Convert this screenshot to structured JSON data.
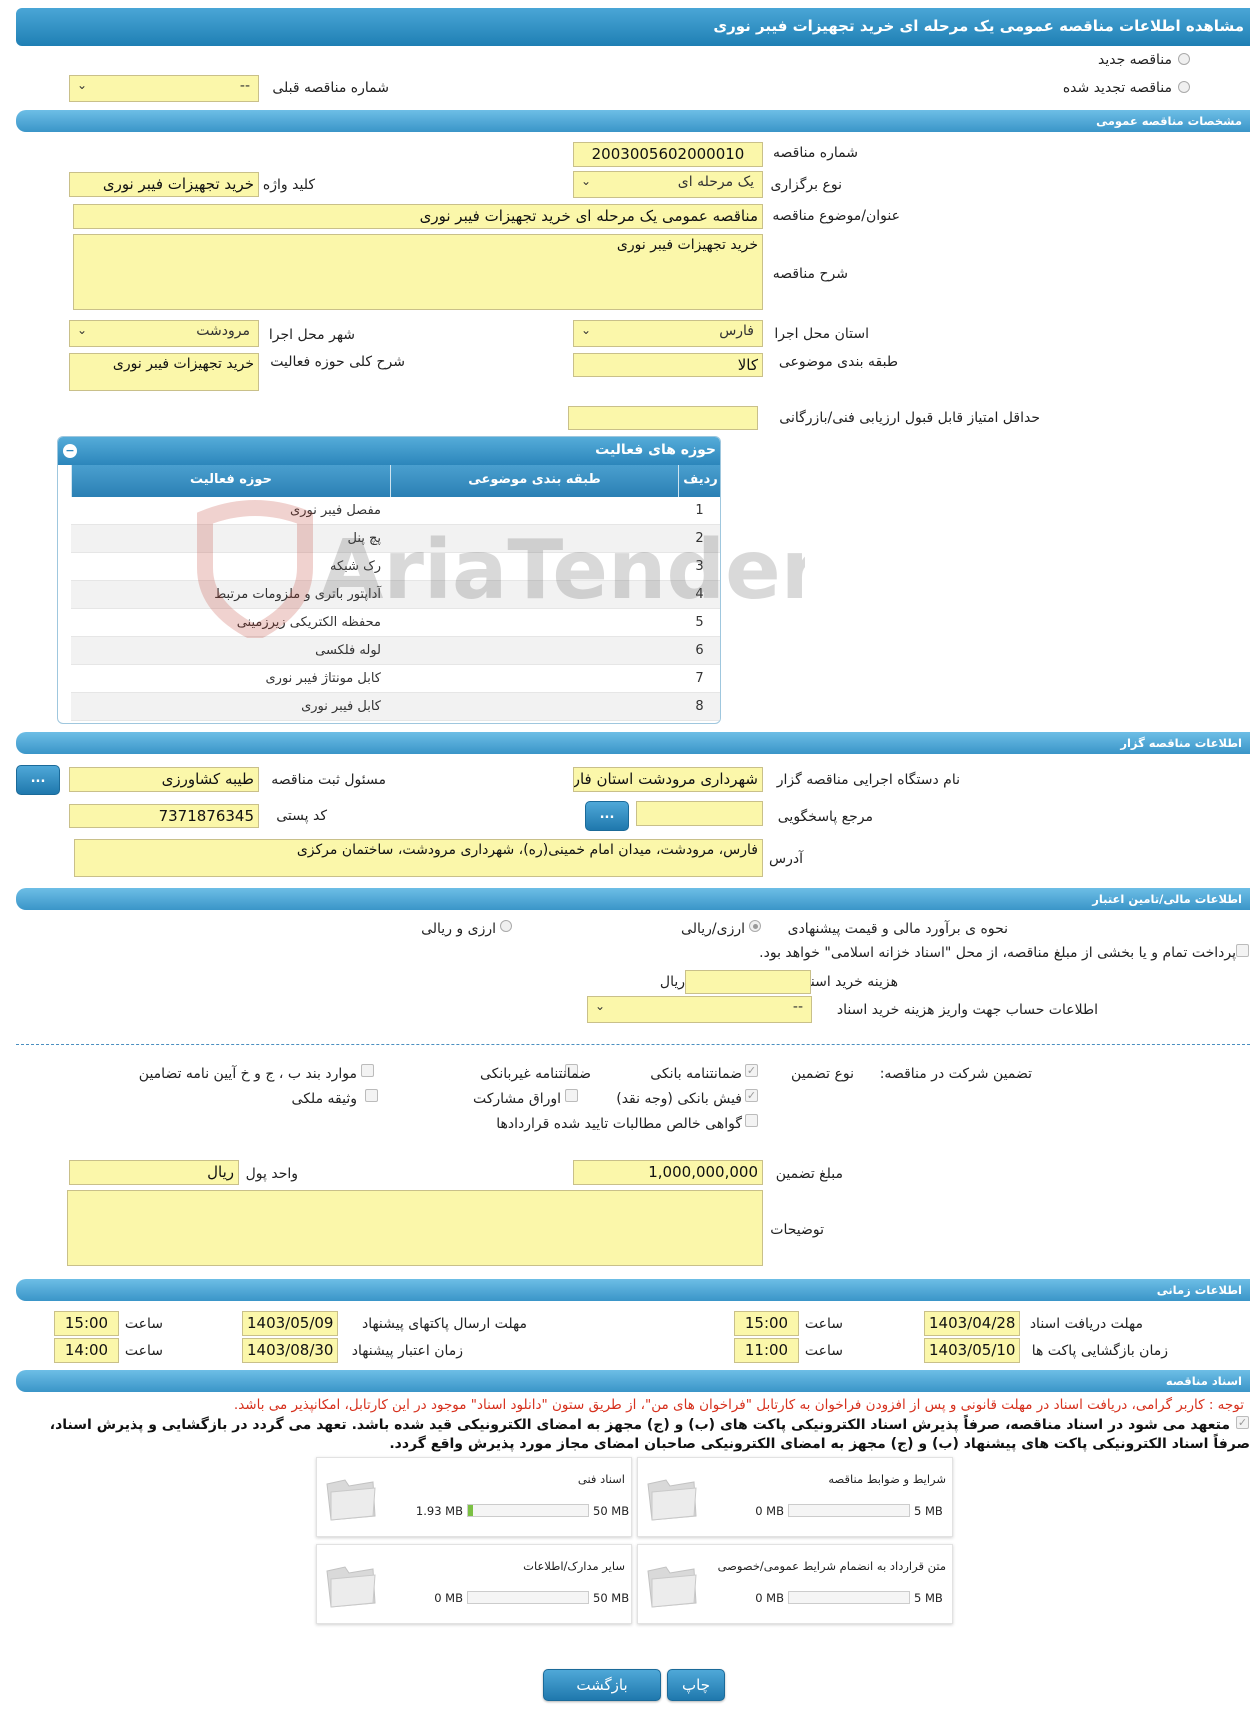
{
  "page": {
    "title": "مشاهده اطلاعات مناقصه عمومی یک مرحله ای خرید تجهیزات فیبر نوری"
  },
  "top": {
    "radio_new": "مناقصه جدید",
    "radio_renewed": "مناقصه تجدید شده",
    "prev_number_label": "شماره مناقصه قبلی",
    "prev_number_value": "--"
  },
  "general": {
    "header": "مشخصات مناقصه عمومی",
    "number_label": "شماره مناقصه",
    "number_value": "2003005602000010",
    "type_label": "نوع برگزاری",
    "type_value": "یک مرحله ای",
    "keyword_label": "کلید واژه",
    "keyword_value": "خرید تجهیزات فیبر نوری",
    "subject_label": "عنوان/موضوع مناقصه",
    "subject_value": "مناقصه عمومی یک مرحله ای خرید تجهیزات فیبر نوری",
    "desc_label": "شرح مناقصه",
    "desc_value": "خرید تجهیزات فیبر نوری",
    "province_label": "استان محل اجرا",
    "province_value": "فارس",
    "city_label": "شهر محل اجرا",
    "city_value": "مرودشت",
    "category_label": "طبقه بندی موضوعی",
    "category_value": "کالا",
    "activity_desc_label": "شرح کلی حوزه فعالیت",
    "activity_desc_value": "خرید تجهیزات فیبر نوری",
    "min_score_label": "حداقل امتیاز قابل قبول ارزیابی فنی/بازرگانی",
    "min_score_value": ""
  },
  "activities": {
    "header": "حوزه های فعالیت",
    "collapse_icon": "minus-circle-icon",
    "columns": [
      "ردیف",
      "طبقه بندی موضوعی",
      "حوزه فعالیت"
    ],
    "rows": [
      {
        "n": "1",
        "cat": "",
        "area": "مفصل فیبر نوری"
      },
      {
        "n": "2",
        "cat": "",
        "area": "پچ پنل"
      },
      {
        "n": "3",
        "cat": "",
        "area": "رک شبکه"
      },
      {
        "n": "4",
        "cat": "",
        "area": "آداپتور باتری و ملزومات مرتبط"
      },
      {
        "n": "5",
        "cat": "",
        "area": "محفظه الکتریکی زیرزمینی"
      },
      {
        "n": "6",
        "cat": "",
        "area": "لوله فلکسی"
      },
      {
        "n": "7",
        "cat": "",
        "area": "کابل مونتاژ فیبر نوری"
      },
      {
        "n": "8",
        "cat": "",
        "area": "کابل فیبر نوری"
      }
    ]
  },
  "organizer": {
    "header": "اطلاعات مناقصه گزار",
    "org_label": "نام دستگاه اجرایی مناقصه گزار",
    "org_value": "شهرداری مرودشت استان فارس",
    "registrar_label": "مسئول ثبت مناقصه",
    "registrar_value": "طیبه کشاورزی",
    "ref_label": "مرجع پاسخگویی",
    "ref_value": "",
    "postal_label": "کد پستی",
    "postal_value": "7371876345",
    "address_label": "آدرس",
    "address_value": "فارس، مرودشت، میدان امام خمینی(ره)، شهرداری مرودشت، ساختمان مرکزی",
    "btn_label": "..."
  },
  "finance": {
    "header": "اطلاعات مالی/تامین اعتبار",
    "method_label": "نحوه ی برآورد مالی و قیمت پیشنهادی",
    "opt_rial": "ارزی/ریالی",
    "opt_fx_rial": "ارزی و ریالی",
    "treasury_text": "پرداخت تمام و یا بخشی از مبلغ مناقصه، از محل \"اسناد خزانه اسلامی\" خواهد بود.",
    "doc_fee_label": "هزینه خرید اسناد",
    "doc_fee_value": "",
    "doc_fee_unit": "ریال",
    "account_label": "اطلاعات حساب جهت واریز هزینه خرید اسناد",
    "account_value": "--"
  },
  "guarantee": {
    "title": "تضمین شرکت در مناقصه:",
    "type_label": "نوع تضمین",
    "options": {
      "bank_guarantee": "ضمانتنامه بانکی",
      "non_bank_guarantee": "ضمانتنامه غیربانکی",
      "other_cases": "موارد بند ب ، ج و خ آیین نامه تضامین",
      "bank_receipt": "فیش بانکی (وجه نقد)",
      "bonds": "اوراق مشارکت",
      "property": "وثیقه ملکی",
      "net_claims": "گواهی خالص مطالبات تایید شده قراردادها"
    },
    "amount_label": "مبلغ تضمین",
    "amount_value": "1,000,000,000",
    "currency_label": "واحد پول",
    "currency_value": "ریال",
    "notes_label": "توضیحات",
    "notes_value": ""
  },
  "timing": {
    "header": "اطلاعات زمانی",
    "doc_deadline_label": "مهلت دریافت اسناد",
    "doc_deadline_date": "1403/04/28",
    "doc_deadline_time": "15:00",
    "submit_deadline_label": "مهلت ارسال پاکتهای پیشنهاد",
    "submit_deadline_date": "1403/05/09",
    "submit_deadline_time": "15:00",
    "opening_label": "زمان بازگشایی پاکت ها",
    "opening_date": "1403/05/10",
    "opening_time": "11:00",
    "validity_label": "زمان اعتبار پیشنهاد",
    "validity_date": "1403/08/30",
    "validity_time": "14:00",
    "hour_label": "ساعت"
  },
  "documents": {
    "header": "اسناد مناقصه",
    "note_red": "توجه : کاربر گرامی، دریافت اسناد در مهلت قانونی و پس از افزودن فراخوان به کارتابل \"فراخوان های من\"، از طریق ستون \"دانلود اسناد\" موجود در این کارتابل، امکانپذیر می باشد.",
    "commit_line1": "متعهد می شود در اسناد مناقصه، صرفاً پذیرش اسناد الکترونیکی پاکت های (ب) و (ج) مجهز به امضای الکترونیکی قید شده باشد. تعهد می گردد در بازگشایی و پذیرش اسناد،",
    "commit_line2": "صرفاً اسناد الکترونیکی پاکت های پیشنهاد (ب) و (ج) مجهز به امضای الکترونیکی صاحبان امضای مجاز مورد پذیرش واقع گردد.",
    "files": [
      {
        "name": "شرایط و ضوابط مناقصه",
        "current": "0 MB",
        "max": "5 MB",
        "fraction": 0
      },
      {
        "name": "اسناد فنی",
        "current": "1.93 MB",
        "max": "50 MB",
        "fraction": 0.0386
      },
      {
        "name": "متن قرارداد به انضمام شرایط عمومی/خصوصی",
        "current": "0 MB",
        "max": "5 MB",
        "fraction": 0
      },
      {
        "name": "سایر مدارک/اطلاعات",
        "current": "0 MB",
        "max": "50 MB",
        "fraction": 0
      }
    ]
  },
  "actions": {
    "print": "چاپ",
    "back": "بازگشت"
  },
  "watermark": {
    "text": "AriaTender.neT"
  },
  "colors": {
    "accent": "#2c86bb",
    "field_bg": "#fbf7aa",
    "note_red": "#d6301d"
  }
}
